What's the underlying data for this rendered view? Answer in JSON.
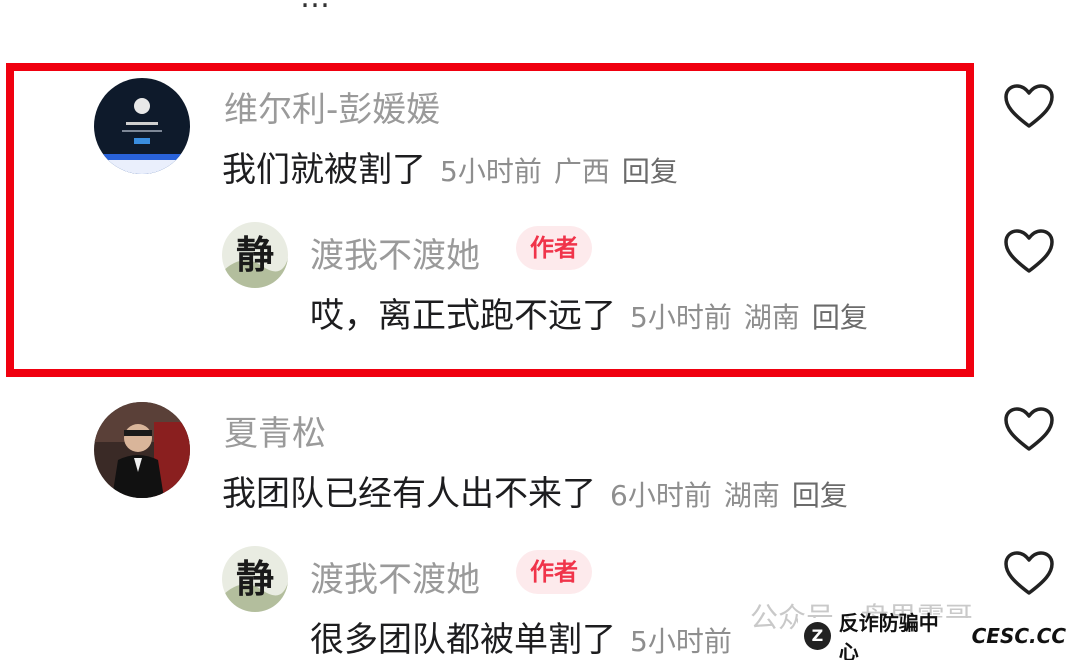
{
  "top_partial_text": "…",
  "comments": [
    {
      "username": "维尔利-彭媛媛",
      "text": "我们就被割了",
      "time": "5小时前",
      "location": "广西",
      "reply_label": "回复",
      "replies": [
        {
          "username": "渡我不渡她",
          "badge": "作者",
          "avatar_char": "静",
          "text": "哎，离正式跑不远了",
          "time": "5小时前",
          "location": "湖南",
          "reply_label": "回复"
        }
      ]
    },
    {
      "username": "夏青松",
      "text": "我团队已经有人出不来了",
      "time": "6小时前",
      "location": "湖南",
      "reply_label": "回复",
      "replies": [
        {
          "username": "渡我不渡她",
          "badge": "作者",
          "avatar_char": "静",
          "text": "很多团队都被单割了",
          "time": "5小时前"
        }
      ]
    }
  ],
  "watermark": {
    "text": "公众号 · 盘界震哥",
    "badge_logo": "Z",
    "badge_text": "反诈防骗中心",
    "badge_site": "CESC.CC"
  },
  "colors": {
    "highlight": "#f0000f",
    "author_badge_bg": "#fdeaec",
    "author_badge_text": "#f0344a"
  }
}
